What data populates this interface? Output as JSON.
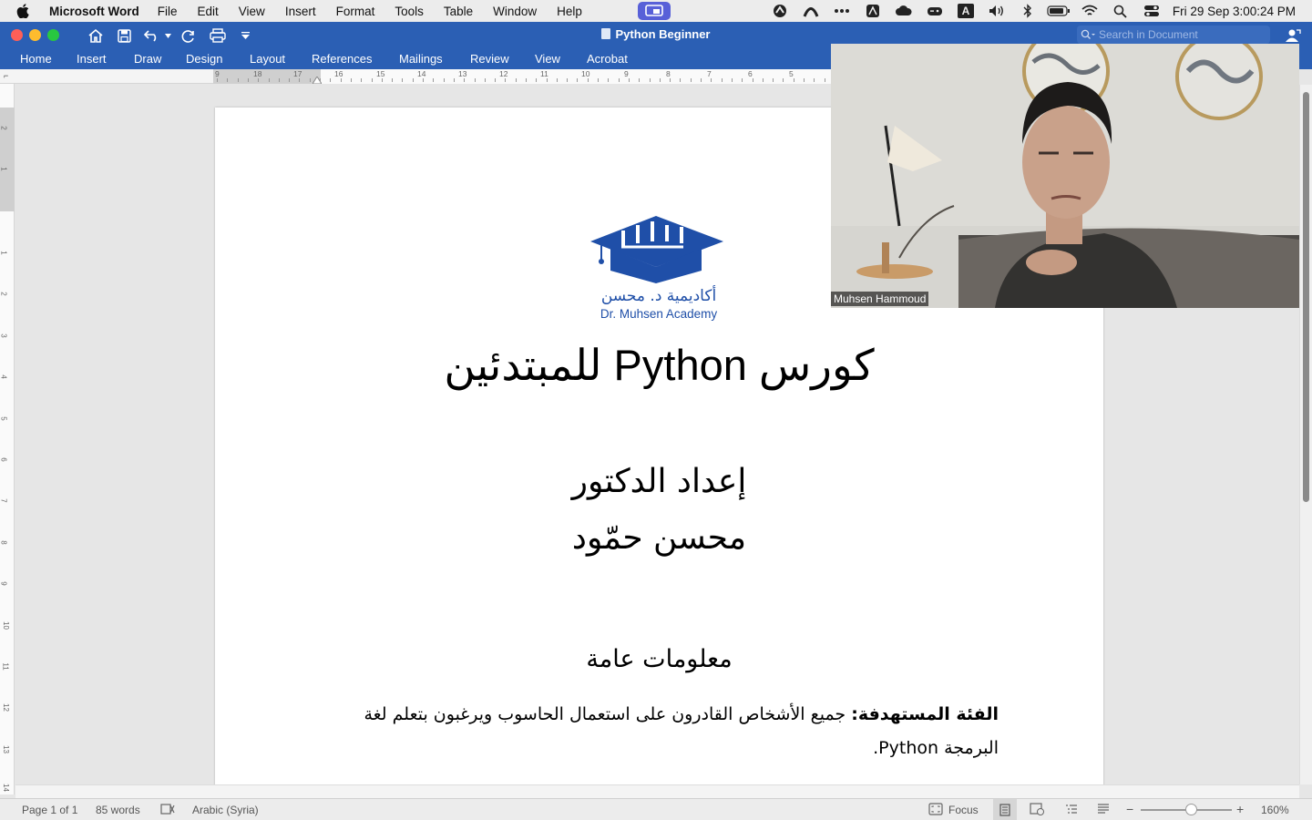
{
  "menubar": {
    "app_name": "Microsoft Word",
    "items": [
      "File",
      "Edit",
      "View",
      "Insert",
      "Format",
      "Tools",
      "Table",
      "Window",
      "Help"
    ],
    "clock": "Fri 29 Sep  3:00:24 PM",
    "input_source": "A"
  },
  "window": {
    "title": "Python Beginner",
    "search_placeholder": "Search in Document",
    "ribbon_tabs": [
      "Home",
      "Insert",
      "Draw",
      "Design",
      "Layout",
      "References",
      "Mailings",
      "Review",
      "View",
      "Acrobat"
    ],
    "accent_color": "#2b5fb4"
  },
  "ruler": {
    "horizontal_numbers": [
      "18",
      "17",
      "16",
      "15",
      "14",
      "13",
      "12",
      "11",
      "10",
      "9",
      "8",
      "7",
      "6",
      "5"
    ],
    "vertical_numbers": [
      "2",
      "1",
      "1",
      "2",
      "3",
      "4",
      "5",
      "6",
      "7",
      "8",
      "9",
      "10",
      "11",
      "12",
      "13",
      "14"
    ]
  },
  "document": {
    "logo_arabic": "أكاديمية د. محسن",
    "logo_english": "Dr. Muhsen Academy",
    "title": "كورس Python للمبتدئين",
    "prepared_by": "إعداد الدكتور",
    "author": "محسن حمّود",
    "section_heading": "معلومات عامة",
    "audience_label": "الفئة المستهدفة:",
    "audience_text": " جميع الأشخاص القادرون على استعمال الحاسوب ويرغبون بتعلم لغة البرمجة Python."
  },
  "video": {
    "participant_name": "Muhsen Hammoud"
  },
  "statusbar": {
    "page": "Page 1 of 1",
    "words": "85 words",
    "language": "Arabic (Syria)",
    "focus": "Focus",
    "zoom": "160%"
  }
}
